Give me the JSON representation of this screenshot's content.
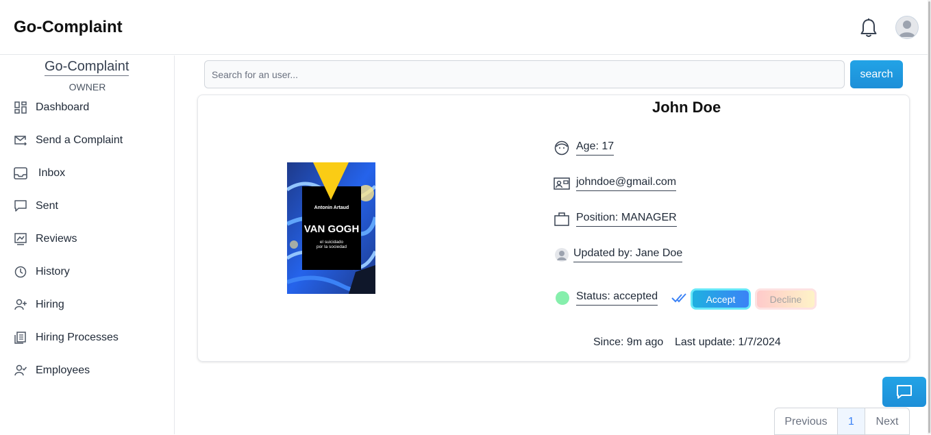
{
  "header": {
    "app_title": "Go-Complaint",
    "bell_icon": "bell-icon",
    "avatar_icon": "user-avatar-icon"
  },
  "sidebar": {
    "brand": "Go-Complaint",
    "role": "OWNER",
    "items": [
      {
        "label": "Dashboard",
        "icon": "dashboard-icon"
      },
      {
        "label": "Send a Complaint",
        "icon": "mail-send-icon"
      },
      {
        "label": "Inbox",
        "icon": "inbox-icon"
      },
      {
        "label": "Sent",
        "icon": "chat-sent-icon"
      },
      {
        "label": "Reviews",
        "icon": "reviews-icon"
      },
      {
        "label": "History",
        "icon": "clock-icon"
      },
      {
        "label": "Hiring",
        "icon": "user-plus-icon"
      },
      {
        "label": "Hiring Processes",
        "icon": "document-list-icon"
      },
      {
        "label": "Employees",
        "icon": "user-check-icon"
      }
    ]
  },
  "search": {
    "placeholder": "Search for an user...",
    "value": "",
    "button_label": "search"
  },
  "profile": {
    "name": "John Doe",
    "age": "Age: 17",
    "email": "johndoe@gmail.com",
    "position": "Position: MANAGER",
    "updated_by": "Updated by: Jane Doe",
    "status": "Status: accepted",
    "status_color": "#86efac",
    "accept_label": "Accept",
    "decline_label": "Decline",
    "since": "Since: 9m ago",
    "last_update": "Last update: 1/7/2024",
    "image": {
      "author": "Antonin Artaud",
      "title": "VAN GOGH",
      "subtitle_line1": "el suicidado",
      "subtitle_line2": "por la sociedad"
    }
  },
  "pagination": {
    "previous_label": "Previous",
    "current_page": "1",
    "next_label": "Next"
  },
  "colors": {
    "accent": "#1d9be0",
    "accept": "#3b82f6",
    "decline": "#fecaca"
  }
}
